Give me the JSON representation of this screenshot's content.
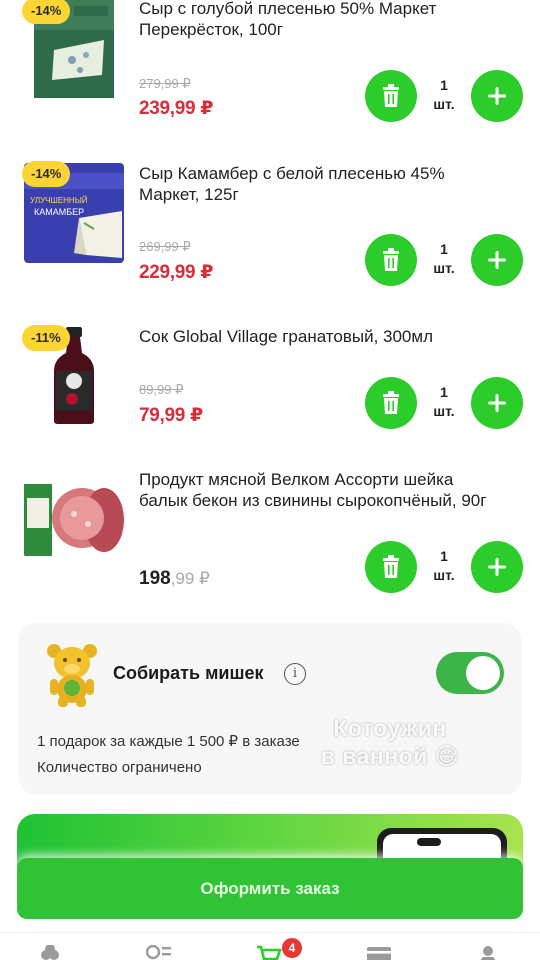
{
  "products": [
    {
      "discount": "-14%",
      "name": "Сыр с голубой плесенью 50% Маркет Перекрёсток, 100г",
      "old_price": "279,99 ₽",
      "new_price": "239,99 ₽",
      "qty": "1",
      "unit": "шт."
    },
    {
      "discount": "-14%",
      "name": "Сыр Камамбер с белой плесенью 45% Маркет, 125г",
      "old_price": "269,99 ₽",
      "new_price": "229,99 ₽",
      "qty": "1",
      "unit": "шт."
    },
    {
      "discount": "-11%",
      "name": "Сок Global Village гранатовый, 300мл",
      "old_price": "89,99 ₽",
      "new_price": "79,99 ₽",
      "qty": "1",
      "unit": "шт."
    },
    {
      "name": "Продукт мясной Велком Ассорти шейка балык бекон из свинины сырокопчёный, 90г",
      "price_int": "198",
      "price_kop": ",99 ₽",
      "qty": "1",
      "unit": "шт."
    }
  ],
  "bears": {
    "title": "Собирать мишек",
    "info": "i",
    "toggle_on": true,
    "desc1": "1 подарок за каждые 1 500 ₽ в заказе",
    "desc2": "Количество ограничено"
  },
  "overlay": {
    "line1": "Котоужин",
    "line2": "в ванной",
    "emoji": "😅"
  },
  "checkout": {
    "label": "Оформить заказ"
  },
  "nav": {
    "cart_count": "4"
  },
  "colors": {
    "accent_green": "#2ccd2b",
    "discount_yellow": "#fcd535",
    "price_red": "#d92d3a"
  }
}
